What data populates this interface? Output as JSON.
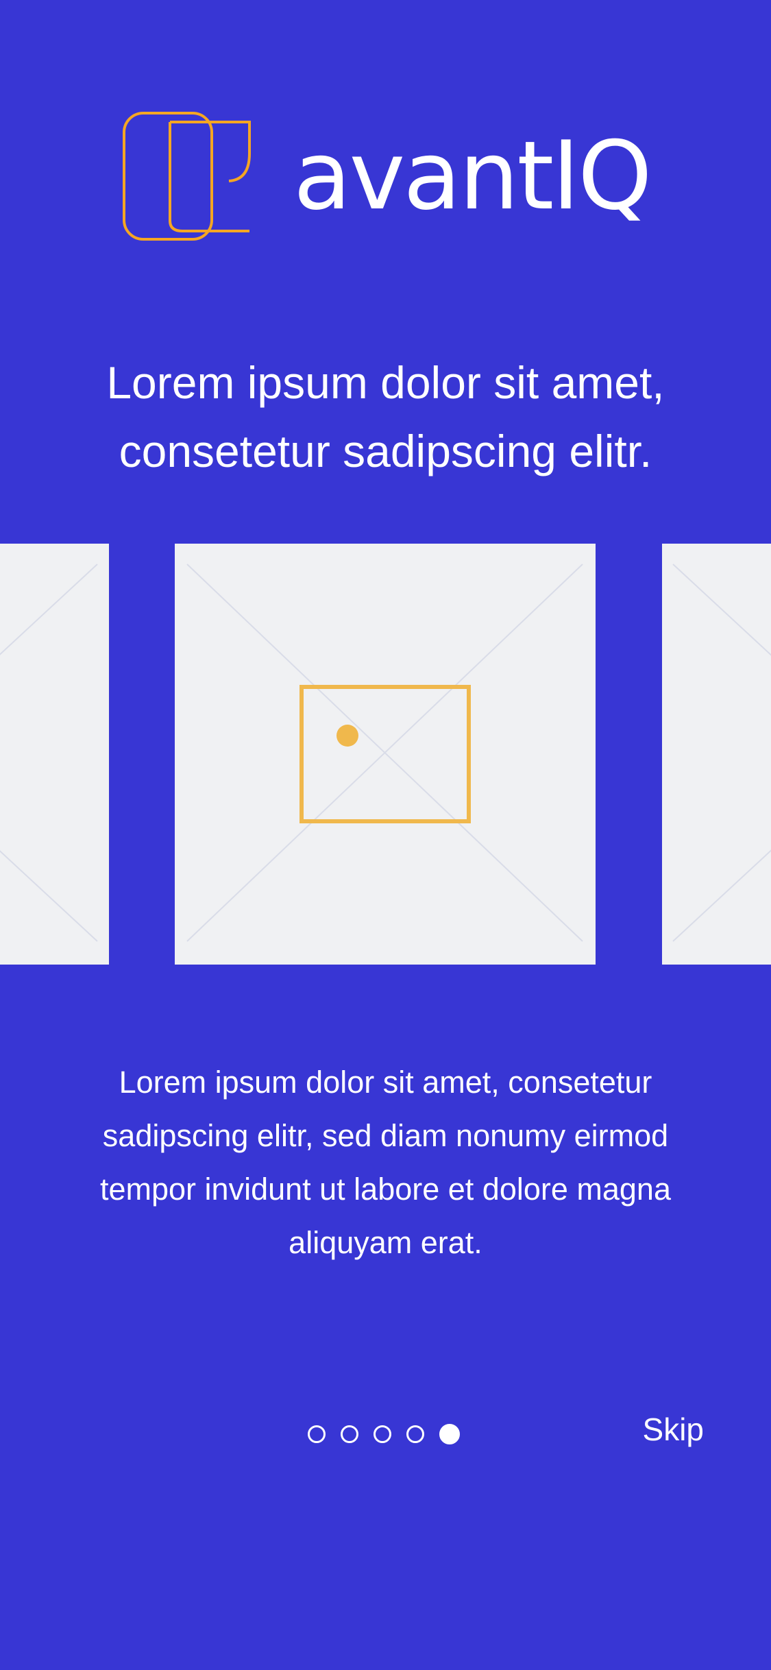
{
  "brand": {
    "name": "avantIQ",
    "logo_icon": "avantiq-logo-icon",
    "logo_color": "#F5A623"
  },
  "headline": "Lorem ipsum dolor sit amet, consetetur sadipscing elitr.",
  "carousel": {
    "image_icon": "image-placeholder-icon",
    "image_icon_color": "#F0B84C"
  },
  "description": "Lorem ipsum dolor sit amet, consetetur sadipscing elitr, sed diam nonumy eirmod tempor invidunt ut labore et dolore magna aliquyam erat.",
  "pagination": {
    "total": 5,
    "current": 5
  },
  "skip_label": "Skip",
  "colors": {
    "background": "#3836D4",
    "slide": "#F0F1F3",
    "text": "#FFFFFF"
  }
}
